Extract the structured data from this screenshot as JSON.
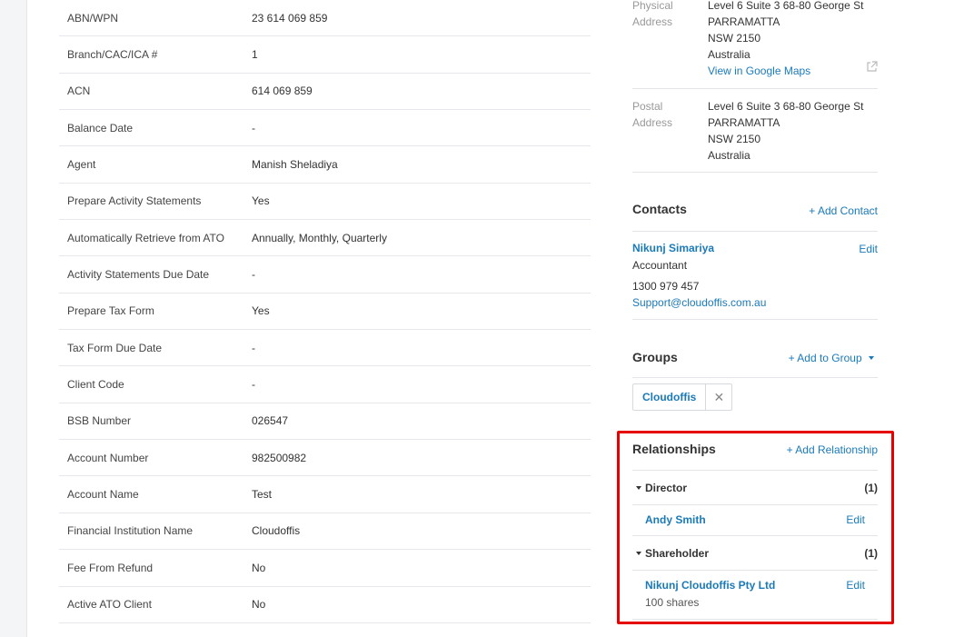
{
  "fields": [
    {
      "label": "ABN/WPN",
      "value": "23 614 069 859"
    },
    {
      "label": "Branch/CAC/ICA #",
      "value": "1"
    },
    {
      "label": "ACN",
      "value": "614 069 859"
    },
    {
      "label": "Balance Date",
      "value": "-"
    },
    {
      "label": "Agent",
      "value": "Manish Sheladiya"
    },
    {
      "label": "Prepare Activity Statements",
      "value": "Yes"
    },
    {
      "label": "Automatically Retrieve from ATO",
      "value": "Annually, Monthly, Quarterly"
    },
    {
      "label": "Activity Statements Due Date",
      "value": "-"
    },
    {
      "label": "Prepare Tax Form",
      "value": "Yes"
    },
    {
      "label": "Tax Form Due Date",
      "value": "-"
    },
    {
      "label": "Client Code",
      "value": "-"
    },
    {
      "label": "BSB Number",
      "value": "026547"
    },
    {
      "label": "Account Number",
      "value": "982500982"
    },
    {
      "label": "Account Name",
      "value": "Test"
    },
    {
      "label": "Financial Institution Name",
      "value": "Cloudoffis"
    },
    {
      "label": "Fee From Refund",
      "value": "No"
    },
    {
      "label": "Active ATO Client",
      "value": "No"
    }
  ],
  "physical_address": {
    "label_1": "Physical",
    "label_2": "Address",
    "line1": "Level 6 Suite 3 68-80 George St",
    "line2": "PARRAMATTA",
    "line3": "NSW 2150",
    "line4": "Australia",
    "map_link": "View in Google Maps"
  },
  "postal_address": {
    "label_1": "Postal",
    "label_2": "Address",
    "line1": "Level 6 Suite 3 68-80 George St",
    "line2": "PARRAMATTA",
    "line3": "NSW 2150",
    "line4": "Australia"
  },
  "contacts": {
    "title": "Contacts",
    "add_label": "+ Add Contact",
    "name": "Nikunj Simariya",
    "role": "Accountant",
    "phone": "1300 979 457",
    "email": "Support@cloudoffis.com.au",
    "edit_label": "Edit"
  },
  "groups": {
    "title": "Groups",
    "add_label": "+ Add to Group",
    "chip_label": "Cloudoffis",
    "chip_remove": "✕"
  },
  "relationships": {
    "title": "Relationships",
    "add_label": "+ Add Relationship",
    "groups": [
      {
        "name": "Director",
        "count": "(1)",
        "member": "Andy Smith",
        "sub": "",
        "edit": "Edit"
      },
      {
        "name": "Shareholder",
        "count": "(1)",
        "member": "Nikunj Cloudoffis Pty Ltd",
        "sub": "100 shares",
        "edit": "Edit"
      }
    ]
  },
  "colors": {
    "link": "#1a7ab9",
    "highlight": "#e60000"
  }
}
